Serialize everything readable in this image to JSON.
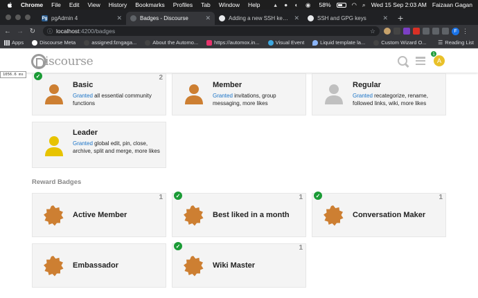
{
  "menubar": {
    "app": "Chrome",
    "items": [
      "File",
      "Edit",
      "View",
      "History",
      "Bookmarks",
      "Profiles",
      "Tab",
      "Window",
      "Help"
    ],
    "battery": "58%",
    "datetime": "Wed 15 Sep  2:03 AM",
    "user": "Faizaan Gagan"
  },
  "tabs": [
    {
      "title": "pgAdmin 4",
      "favicon": "Pg",
      "color": "#2a5d91",
      "active": false
    },
    {
      "title": "Badges - Discourse",
      "favicon": "",
      "color": "#5f6368",
      "active": true
    },
    {
      "title": "Adding a new SSH key to your",
      "favicon": "",
      "color": "#202124",
      "active": false
    },
    {
      "title": "SSH and GPG keys",
      "favicon": "",
      "color": "#202124",
      "active": false
    }
  ],
  "toolbar": {
    "url_host": "localhost",
    "url_path": ":4200/badges",
    "profile_initial": "F"
  },
  "bookmarks": {
    "items": [
      "Apps",
      "Discourse Meta",
      "assigned:fzngaga...",
      "About the Automo...",
      "https://automox.in...",
      "Visual Event",
      "Liquid template la...",
      "Custom Wizard O..."
    ],
    "reading_list": "Reading List"
  },
  "header": {
    "logo_text": "iscourse",
    "avatar_initial": "A",
    "notifications": "1"
  },
  "timing": "1056.6 ms",
  "badge_groups": {
    "top": [
      {
        "name": "Basic",
        "granted": "Granted",
        "desc": "all essential community functions",
        "count": "2",
        "checked": true,
        "color": "#cd7f32",
        "icon": "user-icon"
      },
      {
        "name": "Member",
        "granted": "Granted",
        "desc": "invitations, group messaging, more likes",
        "count": "",
        "checked": false,
        "color": "#cd7f32",
        "icon": "user-icon"
      },
      {
        "name": "Regular",
        "granted": "Granted",
        "desc": "recategorize, rename, followed links, wiki, more likes",
        "count": "",
        "checked": false,
        "color": "#c0c0c0",
        "icon": "user-icon"
      },
      {
        "name": "Leader",
        "granted": "Granted",
        "desc": "global edit, pin, close, archive, split and merge, more likes",
        "count": "",
        "checked": false,
        "color": "#e7c300",
        "icon": "user-icon"
      }
    ],
    "reward_title": "Reward Badges",
    "reward": [
      {
        "name": "Active Member",
        "count": "1",
        "checked": false,
        "color": "#cd7f32",
        "icon": "certificate-icon"
      },
      {
        "name": "Best liked in a month",
        "count": "1",
        "checked": true,
        "color": "#cd7f32",
        "icon": "certificate-icon"
      },
      {
        "name": "Conversation Maker",
        "count": "1",
        "checked": true,
        "color": "#cd7f32",
        "icon": "certificate-icon"
      },
      {
        "name": "Embassador",
        "count": "",
        "checked": false,
        "color": "#cd7f32",
        "icon": "certificate-icon"
      },
      {
        "name": "Wiki Master",
        "count": "1",
        "checked": true,
        "color": "#cd7f32",
        "icon": "certificate-icon"
      }
    ]
  }
}
